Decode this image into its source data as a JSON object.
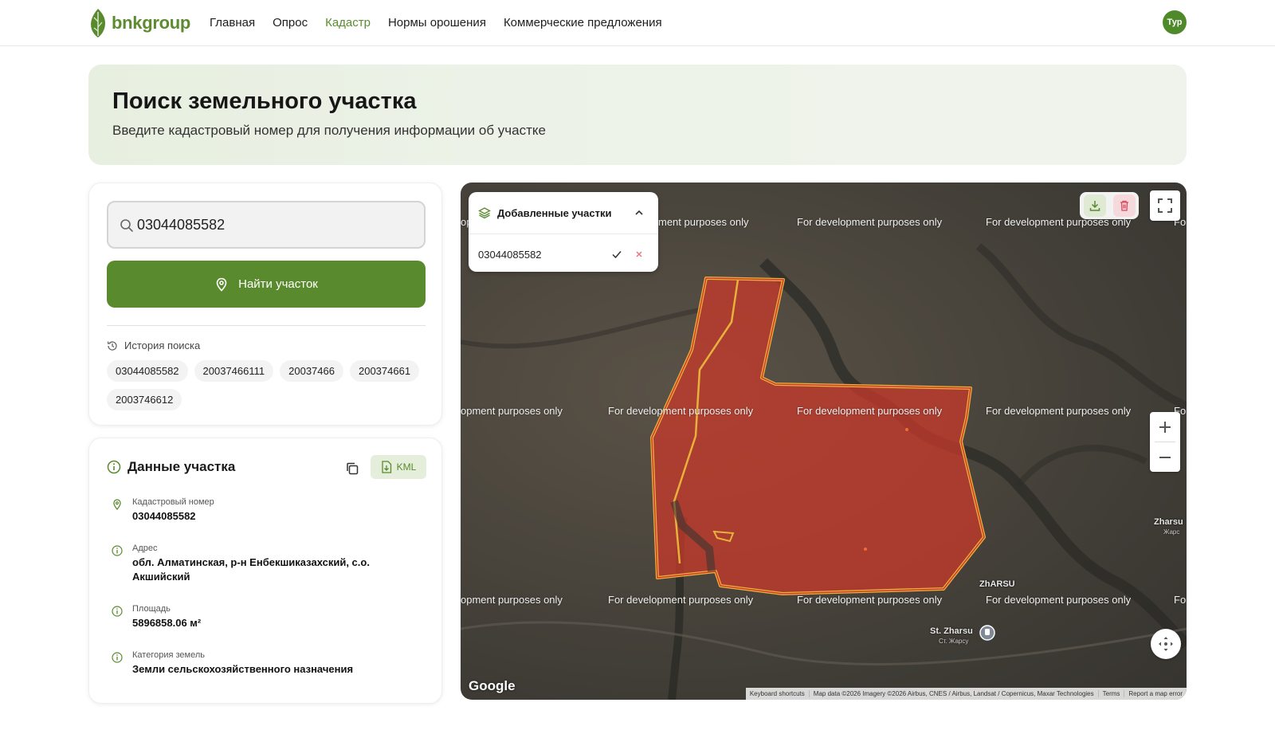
{
  "brand": {
    "name": "bnkgroup"
  },
  "nav": [
    {
      "label": "Главная",
      "active": false
    },
    {
      "label": "Опрос",
      "active": false
    },
    {
      "label": "Кадастр",
      "active": true
    },
    {
      "label": "Нормы орошения",
      "active": false
    },
    {
      "label": "Коммерческие предложения",
      "active": false
    }
  ],
  "user": {
    "initials": "Тур"
  },
  "hero": {
    "title": "Поиск земельного участка",
    "subtitle": "Введите кадастровый номер для получения информации об участке"
  },
  "search": {
    "value": "03044085582",
    "button_label": "Найти участок",
    "history_label": "История поиска",
    "history": [
      "03044085582",
      "20037466111",
      "20037466",
      "200374661",
      "2003746612"
    ]
  },
  "parcel": {
    "title": "Данные участка",
    "kml_label": "KML",
    "fields": [
      {
        "label": "Кадастровый номер",
        "value": "03044085582",
        "icon": "location-pin-icon"
      },
      {
        "label": "Адрес",
        "value": "обл. Алматинская, р-н Енбекшиказахский, с.о. Акшийский",
        "icon": "info-icon"
      },
      {
        "label": "Площадь",
        "value": "5896858.06 м²",
        "icon": "info-icon"
      },
      {
        "label": "Категория земель",
        "value": "Земли сельскохозяйственного назначения",
        "icon": "info-icon"
      }
    ]
  },
  "map": {
    "added_panel": {
      "title": "Добавленные участки",
      "items": [
        "03044085582"
      ]
    },
    "watermark": "For development purposes only",
    "watermark_partial_left": "opment purposes only",
    "watermark_partial_left_top": "op",
    "watermark_partial_top2": "ment purposes only",
    "watermark_partial_right": "Fo",
    "places": {
      "zharsu": "ZhARSU",
      "st_zharsu": "St. Zharsu",
      "st_zharsu_sub": "Ст. Жарсу",
      "zharsu_right": "Zharsu",
      "zharsu_right_sub": "Жарс"
    },
    "google": "Google",
    "attribution": [
      "Keyboard shortcuts",
      "Map data ©2026 Imagery ©2026 Airbus, CNES / Airbus, Landsat / Copernicus, Maxar Technologies",
      "Terms",
      "Report a map error"
    ],
    "colors": {
      "parcel_fill": "#c9392b",
      "parcel_stroke": "#e8b23a"
    }
  },
  "colors": {
    "brand": "#5a8a2e",
    "accent": "#5a8e2c"
  }
}
